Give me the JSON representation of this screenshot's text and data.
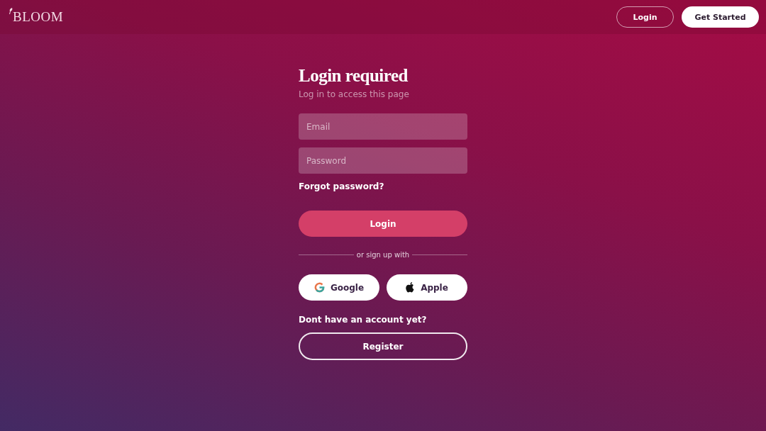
{
  "header": {
    "logo": "BLOOM",
    "login_button": "Login",
    "get_started_button": "Get Started"
  },
  "form": {
    "title": "Login required",
    "subtitle": "Log in to access this page",
    "fields": [
      {
        "placeholder": "Email"
      },
      {
        "placeholder": "Password"
      }
    ],
    "forgot_link": "Forgot password?",
    "submit_button": "Login",
    "divider_text": "or sign up with",
    "social_buttons": [
      {
        "kind": "google",
        "label": "Google"
      },
      {
        "kind": "apple",
        "label": "Apple"
      }
    ],
    "register_prompt": "Dont have an account yet?",
    "register_button": "Register"
  }
}
